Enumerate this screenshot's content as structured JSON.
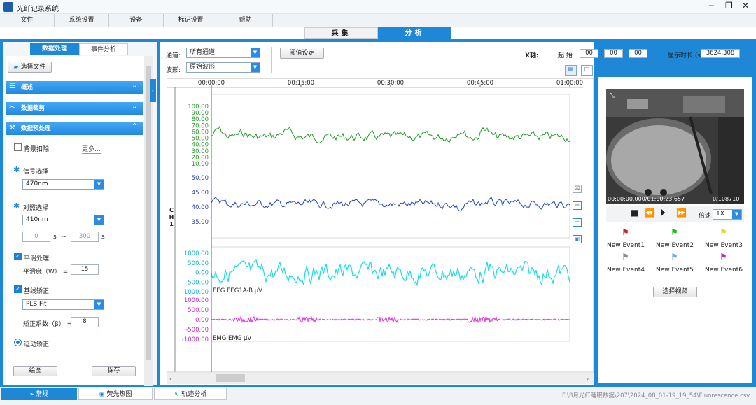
{
  "app": {
    "title": "光纤记录系统",
    "brand_color": "#1e87d6"
  },
  "menu": [
    "文件",
    "系统设置",
    "设备",
    "标记设置",
    "帮助"
  ],
  "modes": [
    "采集",
    "分析"
  ],
  "left": {
    "tabs": [
      "数据处理",
      "事件分析"
    ],
    "choose_file": "选择文件",
    "sections": [
      "概述",
      "数据裁剪",
      "数据预处理"
    ],
    "bg_subtract": "背景扣除",
    "more": "更多...",
    "signal_label": "信号选择",
    "signal_value": "470nm",
    "ref_label": "对照选择",
    "ref_value": "410nm",
    "range_from": "0",
    "range_to": "300",
    "unit_s": "s",
    "dash": "~",
    "smooth_label": "平滑处理",
    "smooth_w_label": "平滑度（W） =",
    "smooth_w": "15",
    "baseline_label": "基线矫正",
    "baseline_value": "PLS Fit",
    "beta_label": "矫正系数（β） =",
    "beta": "8",
    "motion_label": "运动矫正",
    "draw": "绘图",
    "save": "保存"
  },
  "center": {
    "channel_label": "通道:",
    "channel_value": "所有通道",
    "wave_label": "波形:",
    "wave_value": "原始波形",
    "threshold_btn": "阈值设定",
    "xaxis_label": "X轴:",
    "start_label": "起  始",
    "start_h": "00",
    "start_m": "00",
    "start_s": "00",
    "duration_label": "显示时长 (s)",
    "duration_value": "3624.308",
    "time_ticks": [
      "00:00:00",
      "00:15:00",
      "00:30:00",
      "00:45:00",
      "01:00:00"
    ],
    "ch_label": "CH1",
    "green_ticks": [
      "100.00",
      "90.00",
      "80.00",
      "70.00",
      "60.00",
      "50.00",
      "40.00",
      "30.00",
      "20.00",
      "10.00"
    ],
    "blue_ticks": [
      "50.00",
      "45.00",
      "40.00",
      "35.00"
    ],
    "eeg_ticks": [
      "1000.00",
      "500.00",
      "0.00",
      "-500.00",
      "-1000.00"
    ],
    "emg_ticks": [
      "1000.00",
      "500.00",
      "0.00",
      "-500.00",
      "-1000.00"
    ],
    "eeg_label": "EEG EEG1A-B μV",
    "emg_label": "EMG EMG μV",
    "colors": {
      "green": "#1f9a22",
      "blue": "#1f44c8",
      "eeg": "#18dce8",
      "emg": "#e62ee0",
      "cursor": "#e03030",
      "green_ticks": "#2a9a2a",
      "blue_ticks": "#2a45b5",
      "eeg_ticks": "#17b3c6",
      "emg_ticks": "#c52dc4"
    }
  },
  "video": {
    "time": "00:00:00.000/01:00:23.657",
    "frame": "0/108710",
    "speed_label": "倍速",
    "speed_value": "1X",
    "events": [
      "New Event1",
      "New Event2",
      "New Event3",
      "New Event4",
      "New Event5",
      "New Event6"
    ],
    "event_colors": [
      "#d92020",
      "#22b522",
      "#e8d820",
      "#8a8a8a",
      "#6aaee0",
      "#c028c0"
    ],
    "select_video": "选择视频"
  },
  "bottom": {
    "tabs": [
      "常规",
      "荧光热图",
      "轨迹分析"
    ],
    "path": "F:\\8月光纤睡眠数据\\207\\2024_08_01-19_19_54\\Fluorescence.csv"
  }
}
